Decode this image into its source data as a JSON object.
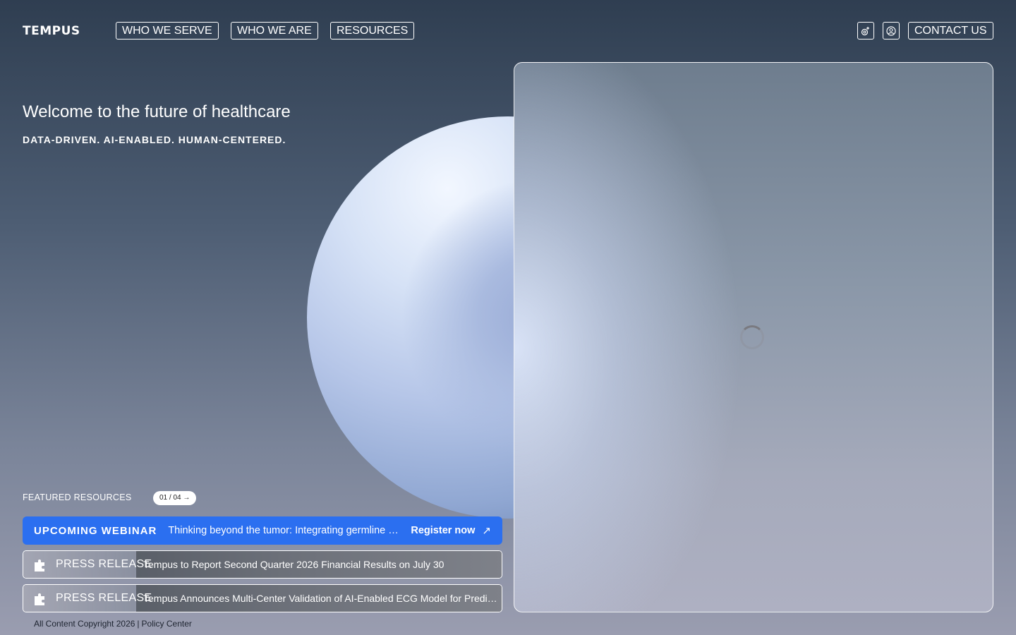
{
  "header": {
    "logo": "TEMPUS",
    "nav": [
      "WHO WE SERVE",
      "WHO WE ARE",
      "RESOURCES"
    ],
    "contact": "CONTACT US",
    "icons": [
      "patient-portal-icon",
      "user-account-icon"
    ]
  },
  "hero": {
    "title": "Welcome to the future of healthcare",
    "subtitle": "DATA-DRIVEN. AI-ENABLED. HUMAN-CENTERED."
  },
  "featured": {
    "label": "FEATURED RESOURCES",
    "pager": "01 / 04 →",
    "webinar": {
      "tag": "UPCOMING WEBINAR",
      "text": "Thinking beyond the tumor: Integrating germline testing into routine cancer care",
      "cta": "Register now",
      "arrow": "↗"
    },
    "press": [
      {
        "tag": "PRESS RELEASE",
        "text": "Tempus to Report Second Quarter 2026 Financial Results on July 30"
      },
      {
        "tag": "PRESS RELEASE",
        "text": "Tempus Announces Multi-Center Validation of AI-Enabled ECG Model for Predicting Atrial Fibrillation"
      }
    ]
  },
  "footer": {
    "copyright": "All Content Copyright 2026",
    "separator": "|",
    "policy": "Policy Center"
  },
  "colors": {
    "accent_blue": "#2b6ff0",
    "text": "#ffffff"
  }
}
